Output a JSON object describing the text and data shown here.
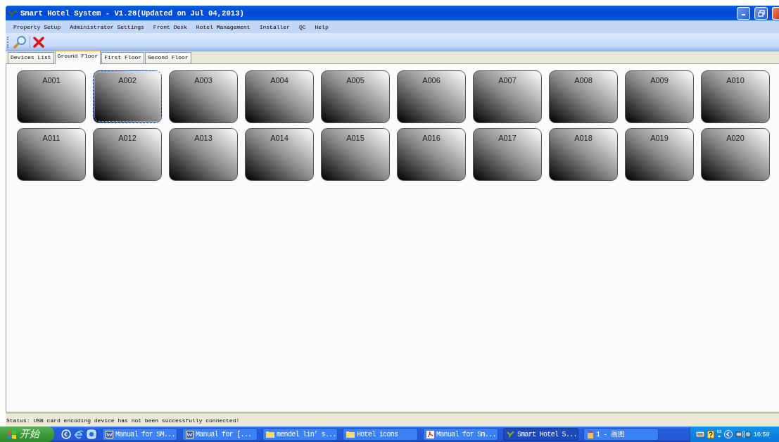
{
  "window": {
    "title": "Smart Hotel System - V1.28(Updated on Jul 04,2013)"
  },
  "menu": [
    "Property Setup",
    "Administrator Settings",
    "Front Desk",
    "Hotel Management",
    "Installer",
    "QC",
    "Help"
  ],
  "tabs": [
    {
      "label": "Devices List",
      "selected": false
    },
    {
      "label": "Ground Floor",
      "selected": true
    },
    {
      "label": "First Floor",
      "selected": false
    },
    {
      "label": "Second Floor",
      "selected": false
    }
  ],
  "rooms": [
    {
      "label": "A001",
      "focused": false
    },
    {
      "label": "A002",
      "focused": true
    },
    {
      "label": "A003",
      "focused": false
    },
    {
      "label": "A004",
      "focused": false
    },
    {
      "label": "A005",
      "focused": false
    },
    {
      "label": "A006",
      "focused": false
    },
    {
      "label": "A007",
      "focused": false
    },
    {
      "label": "A008",
      "focused": false
    },
    {
      "label": "A009",
      "focused": false
    },
    {
      "label": "A010",
      "focused": false
    },
    {
      "label": "A011",
      "focused": false
    },
    {
      "label": "A012",
      "focused": false
    },
    {
      "label": "A013",
      "focused": false
    },
    {
      "label": "A014",
      "focused": false
    },
    {
      "label": "A015",
      "focused": false
    },
    {
      "label": "A016",
      "focused": false
    },
    {
      "label": "A017",
      "focused": false
    },
    {
      "label": "A018",
      "focused": false
    },
    {
      "label": "A019",
      "focused": false
    },
    {
      "label": "A020",
      "focused": false
    }
  ],
  "status_bar": "Status: USB card encoding device has not been successfully connected!",
  "taskbar": {
    "start_label": "开始",
    "tasks": [
      {
        "label": "Manual for SM...",
        "kind": "word",
        "selected": false
      },
      {
        "label": "Manual for [...",
        "kind": "word",
        "selected": false
      },
      {
        "label": "mendel lin’ s...",
        "kind": "folder",
        "selected": false
      },
      {
        "label": "Hotel icons",
        "kind": "folder",
        "selected": false
      },
      {
        "label": "Manual for Sm...",
        "kind": "pdf",
        "selected": false
      },
      {
        "label": "Smart Hotel S...",
        "kind": "app",
        "selected": true
      },
      {
        "label": "1 - 画图",
        "kind": "paint",
        "selected": false
      }
    ],
    "clock": "16:59"
  }
}
